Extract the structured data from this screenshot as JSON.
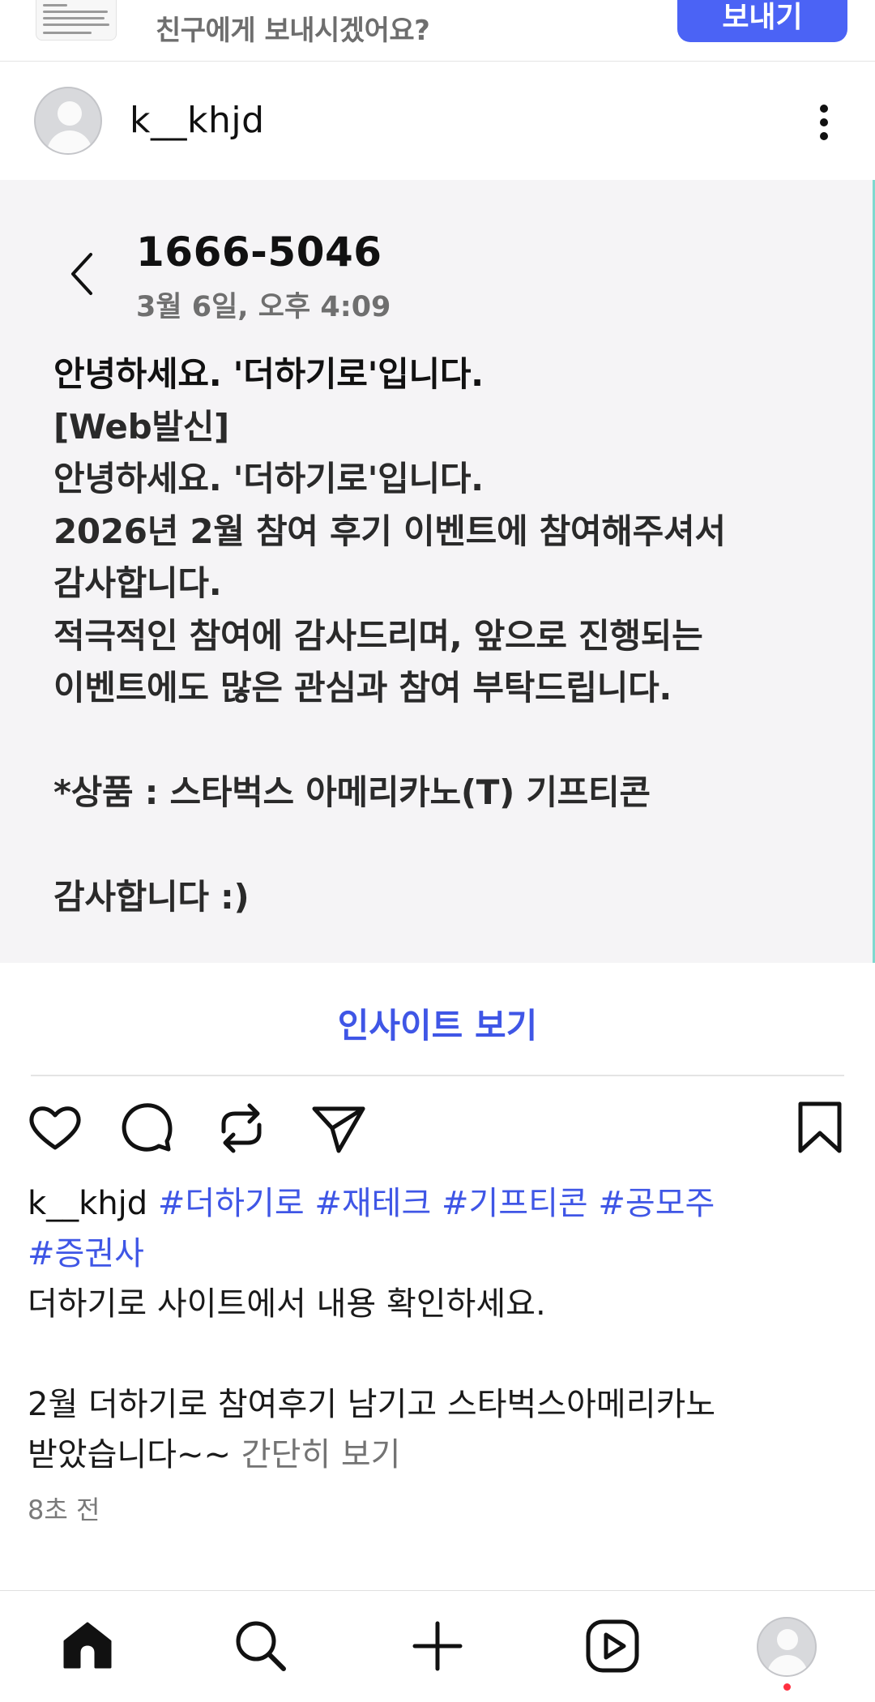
{
  "share_banner": {
    "prompt": "친구에게 보내시겠어요?",
    "send_button": "보내기"
  },
  "post": {
    "username": "k__khjd",
    "image": {
      "sender": "1666-5046",
      "timestamp": "3월 6일, 오후 4:09",
      "message_lines": [
        "안녕하세요. '더하기로'입니다.",
        "[Web발신]",
        "안녕하세요. '더하기로'입니다.",
        "2026년 2월 참여 후기 이벤트에 참여해주셔서",
        "감사합니다.",
        "적극적인 참여에 감사드리며, 앞으로 진행되는",
        "이벤트에도 많은 관심과 참여 부탁드립니다.",
        "",
        "*상품 : 스타벅스 아메리카노(T) 기프티콘",
        "",
        "감사합니다 :)"
      ]
    },
    "insights_label": "인사이트 보기",
    "actions": [
      "heart-icon",
      "comment-icon",
      "repost-icon",
      "share-icon",
      "bookmark-icon"
    ],
    "caption": {
      "username": "k__khjd",
      "hashtags_line1": "#더하기로 #재테크 #기프티콘 #공모주",
      "hashtags_line2": "#증권사",
      "line1": "더하기로 사이트에서 내용 확인하세요.",
      "line2": "2월 더하기로 참여후기 남기고 스타벅스아메리카노",
      "line3": "받았습니다~~",
      "collapse_label": "간단히 보기"
    },
    "time_ago": "8초 전"
  },
  "bottom_nav": [
    "home-icon",
    "search-icon",
    "create-icon",
    "reels-icon",
    "profile-avatar"
  ],
  "colors": {
    "accent": "#4b63f5",
    "link": "#3f56e6",
    "image_bg": "#f5f4f6",
    "notification_dot": "#ff3040"
  }
}
